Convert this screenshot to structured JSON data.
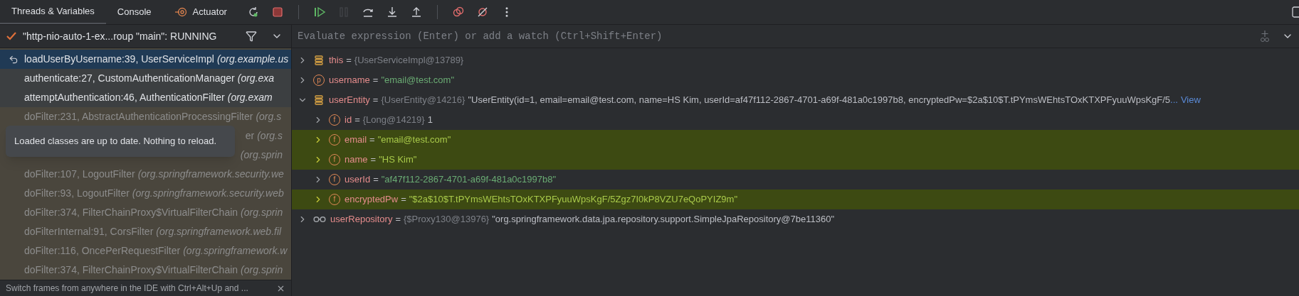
{
  "toolbar": {
    "tabs": [
      {
        "label": "Threads & Variables",
        "selected": true,
        "icon": false
      },
      {
        "label": "Console",
        "selected": false,
        "icon": false
      },
      {
        "label": "Actuator",
        "selected": false,
        "icon": true
      }
    ],
    "actions": [
      {
        "kind": "rerun",
        "disabled": false
      },
      {
        "kind": "stop",
        "disabled": false
      },
      {
        "kind": "sep"
      },
      {
        "kind": "resume",
        "disabled": false
      },
      {
        "kind": "pause",
        "disabled": true
      },
      {
        "kind": "step-over",
        "disabled": false
      },
      {
        "kind": "step-into",
        "disabled": false
      },
      {
        "kind": "step-out",
        "disabled": false
      },
      {
        "kind": "sep"
      },
      {
        "kind": "breakpoints",
        "disabled": false
      },
      {
        "kind": "mute",
        "disabled": false
      },
      {
        "kind": "more",
        "disabled": false
      }
    ]
  },
  "thread": {
    "label": "\"http-nio-auto-1-ex...roup \"main\": RUNNING"
  },
  "evaluate": {
    "placeholder": "Evaluate expression (Enter) or add a watch (Ctrl+Shift+Enter)"
  },
  "frames": [
    {
      "location": "loadUserByUsername:39, UserServiceImpl",
      "package": "(org.example.us",
      "kind": "user",
      "selected": true
    },
    {
      "location": "authenticate:27, CustomAuthenticationManager",
      "package": "(org.exa",
      "kind": "user",
      "selected": false
    },
    {
      "location": "attemptAuthentication:46, AuthenticationFilter",
      "package": "(org.exam",
      "kind": "user",
      "selected": false
    },
    {
      "location": "doFilter:231, AbstractAuthenticationProcessingFilter",
      "package": "(org.s",
      "kind": "library",
      "selected": false
    },
    {
      "location": "er",
      "package": "(org.s",
      "kind": "library",
      "selected": false
    },
    {
      "package": "(org.sprin",
      "kind": "library",
      "selected": false
    },
    {
      "location": "doFilter:107, LogoutFilter",
      "package": "(org.springframework.security.we",
      "kind": "library",
      "selected": false
    },
    {
      "location": "doFilter:93, LogoutFilter",
      "package": "(org.springframework.security.web",
      "kind": "library",
      "selected": false
    },
    {
      "location": "doFilter:374, FilterChainProxy$VirtualFilterChain",
      "package": "(org.sprin",
      "kind": "library",
      "selected": false
    },
    {
      "location": "doFilterInternal:91, CorsFilter",
      "package": "(org.springframework.web.fil",
      "kind": "library",
      "selected": false
    },
    {
      "location": "doFilter:116, OncePerRequestFilter",
      "package": "(org.springframework.w",
      "kind": "library",
      "selected": false
    },
    {
      "location": "doFilter:374, FilterChainProxy$VirtualFilterChain",
      "package": "(org.sprin",
      "kind": "library",
      "selected": false
    }
  ],
  "tooltip": {
    "text": "Loaded classes are up to date. Nothing to reload."
  },
  "hint": {
    "text": "Switch frames from anywhere in the IDE with Ctrl+Alt+Up and ..."
  },
  "variables": [
    {
      "name": "this",
      "kind": "object",
      "operator": "=",
      "type": "{UserServiceImpl@13789}",
      "expanded": false,
      "highlighted": false
    },
    {
      "name": "username",
      "kind": "param",
      "badge": "p",
      "operator": "=",
      "value": "\"email@test.com\"",
      "string": true,
      "expanded": false,
      "highlighted": false
    },
    {
      "name": "userEntity",
      "kind": "object",
      "operator": "=",
      "type": "{UserEntity@14216}",
      "value": "\"UserEntity(id=1, email=email@test.com, name=HS Kim, userId=af47f112-2867-4701-a69f-481a0c1997b8, encryptedPw=$2a$10$T.tPYmsWEhtsTOxKTXPFyuuWpsKgF/5",
      "ellipsis": "...",
      "link": "View",
      "string": false,
      "expanded": true,
      "highlighted": false,
      "children": [
        {
          "name": "id",
          "kind": "field",
          "badge": "f",
          "operator": "=",
          "type": "{Long@14219}",
          "value": "1",
          "string": false,
          "expanded": false,
          "highlighted": false
        },
        {
          "name": "email",
          "kind": "field",
          "badge": "f",
          "operator": "=",
          "value": "\"email@test.com\"",
          "string": true,
          "expanded": false,
          "highlighted": true
        },
        {
          "name": "name",
          "kind": "field",
          "badge": "f",
          "operator": "=",
          "value": "\"HS Kim\"",
          "string": true,
          "expanded": false,
          "highlighted": true
        },
        {
          "name": "userId",
          "kind": "field",
          "badge": "f",
          "operator": "=",
          "value": "\"af47f112-2867-4701-a69f-481a0c1997b8\"",
          "string": true,
          "expanded": false,
          "highlighted": false
        },
        {
          "name": "encryptedPw",
          "kind": "field",
          "badge": "f",
          "operator": "=",
          "value": "\"$2a$10$T.tPYmsWEhtsTOxKTXPFyuuWpsKgF/5Zgz7I0kP8VZU7eQoPYIZ9m\"",
          "string": true,
          "expanded": false,
          "highlighted": true
        }
      ]
    },
    {
      "name": "userRepository",
      "kind": "watch",
      "operator": "=",
      "type": "{$Proxy130@13976}",
      "value": "\"org.springframework.data.jpa.repository.support.SimpleJpaRepository@7be11360\"",
      "string": false,
      "expanded": false,
      "highlighted": false
    }
  ]
}
